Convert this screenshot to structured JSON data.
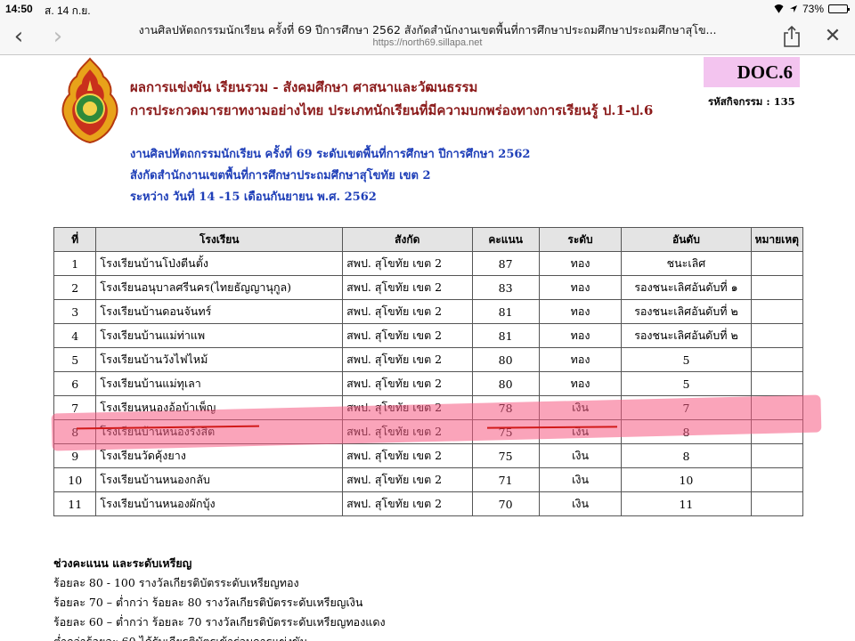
{
  "status_bar": {
    "time": "14:50",
    "date": "ส. 14 ก.ย.",
    "battery": "73%",
    "battery_level": 0.73
  },
  "browser": {
    "page_title": "งานศิลปหัตถกรรมนักเรียน ครั้งที่ 69 ปีการศึกษา 2562 สังกัดสำนักงานเขตพื้นที่การศึกษาประถมศึกษาประถมศึกษาสุโข...",
    "url": "https://north69.sillapa.net",
    "back_glyph": "‹",
    "forward_glyph": "›",
    "close_glyph": "✕"
  },
  "document": {
    "doc_code": "DOC.6",
    "activity_code": "รหัสกิจกรรม : 135",
    "title_line1": "ผลการแข่งขัน เรียนรวม - สังคมศึกษา ศาสนาและวัฒนธรรม",
    "title_line2": "การประกวดมารยาทงามอย่างไทย ประเภทนักเรียนที่มีความบกพร่องทางการเรียนรู้ ป.1-ป.6",
    "subtitle_line1": "งานศิลปหัตถกรรมนักเรียน ครั้งที่ 69 ระดับเขตพื้นที่การศึกษา ปีการศึกษา 2562",
    "subtitle_line2": "สังกัดสำนักงานเขตพื้นที่การศึกษาประถมศึกษาสุโขทัย เขต 2",
    "subtitle_line3": "ระหว่าง วันที่ 14 -15 เดือนกันยายน พ.ศ. 2562",
    "table": {
      "headers": [
        "ที่",
        "โรงเรียน",
        "สังกัด",
        "คะแนน",
        "ระดับ",
        "อันดับ",
        "หมายเหตุ"
      ],
      "rows": [
        [
          "1",
          "โรงเรียนบ้านโป่งตีนตั้ง",
          "สพป. สุโขทัย เขต 2",
          "87",
          "ทอง",
          "ชนะเลิศ",
          ""
        ],
        [
          "2",
          "โรงเรียนอนุบาลศรีนคร(ไทยธัญญานุกูล)",
          "สพป. สุโขทัย เขต 2",
          "83",
          "ทอง",
          "รองชนะเลิศอันดับที่ ๑",
          ""
        ],
        [
          "3",
          "โรงเรียนบ้านดอนจันทร์",
          "สพป. สุโขทัย เขต 2",
          "81",
          "ทอง",
          "รองชนะเลิศอันดับที่ ๒",
          ""
        ],
        [
          "4",
          "โรงเรียนบ้านแม่ท่าแพ",
          "สพป. สุโขทัย เขต 2",
          "81",
          "ทอง",
          "รองชนะเลิศอันดับที่ ๒",
          ""
        ],
        [
          "5",
          "โรงเรียนบ้านวังไฟไหม้",
          "สพป. สุโขทัย เขต 2",
          "80",
          "ทอง",
          "5",
          ""
        ],
        [
          "6",
          "โรงเรียนบ้านแม่ทุเลา",
          "สพป. สุโขทัย เขต 2",
          "80",
          "ทอง",
          "5",
          ""
        ],
        [
          "7",
          "โรงเรียนหนองอ้อบ้าเพ็ญ",
          "สพป. สุโขทัย เขต 2",
          "78",
          "เงิน",
          "7",
          ""
        ],
        [
          "8",
          "โรงเรียนบ้านหนองรังสิต",
          "สพป. สุโขทัย เขต 2",
          "75",
          "เงิน",
          "8",
          ""
        ],
        [
          "9",
          "โรงเรียนวัดคุ้งยาง",
          "สพป. สุโขทัย เขต 2",
          "75",
          "เงิน",
          "8",
          ""
        ],
        [
          "10",
          "โรงเรียนบ้านหนองกลับ",
          "สพป. สุโขทัย เขต 2",
          "71",
          "เงิน",
          "10",
          ""
        ],
        [
          "11",
          "โรงเรียนบ้านหนองผักบุ้ง",
          "สพป. สุโขทัย เขต 2",
          "70",
          "เงิน",
          "11",
          ""
        ]
      ]
    },
    "legend": {
      "title": "ช่วงคะแนน และระดับเหรียญ",
      "lines": [
        "ร้อยละ 80 - 100 รางวัลเกียรติบัตรระดับเหรียญทอง",
        "ร้อยละ 70 – ต่ำกว่า ร้อยละ 80   รางวัลเกียรติบัตรระดับเหรียญเงิน",
        "ร้อยละ 60 – ต่ำกว่า ร้อยละ 70   รางวัลเกียรติบัตรระดับเหรียญทองแดง",
        "ต่ำกว่าร้อยละ 60 ได้รับเกียรติบัตรเข้าร่วมการแข่งขัน"
      ]
    }
  },
  "colors": {
    "title_red": "#8b1a1a",
    "subtitle_blue": "#1f3fb8",
    "doc_code_bg": "#f3c4ef",
    "highlight_pink": "#f55a82",
    "underline_red": "#d21a1a"
  }
}
